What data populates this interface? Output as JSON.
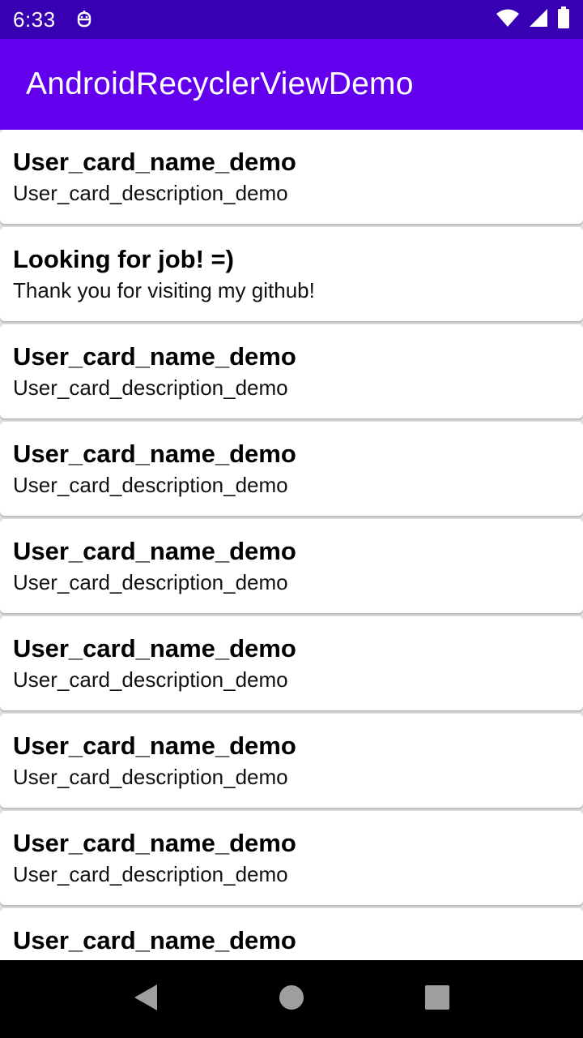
{
  "status_bar": {
    "time": "6:33",
    "icons": [
      "app-notification-icon",
      "wifi-icon",
      "cell-signal-icon",
      "battery-icon"
    ]
  },
  "app_bar": {
    "title": "AndroidRecyclerViewDemo",
    "color": "#6200ee",
    "status_color": "#3700b3"
  },
  "cards": [
    {
      "name": "User_card_name_demo",
      "description": "User_card_description_demo"
    },
    {
      "name": "Looking for job! =)",
      "description": "Thank you for visiting my github!"
    },
    {
      "name": "User_card_name_demo",
      "description": "User_card_description_demo"
    },
    {
      "name": "User_card_name_demo",
      "description": "User_card_description_demo"
    },
    {
      "name": "User_card_name_demo",
      "description": "User_card_description_demo"
    },
    {
      "name": "User_card_name_demo",
      "description": "User_card_description_demo"
    },
    {
      "name": "User_card_name_demo",
      "description": "User_card_description_demo"
    },
    {
      "name": "User_card_name_demo",
      "description": "User_card_description_demo"
    },
    {
      "name": "User_card_name_demo",
      "description": ""
    }
  ],
  "nav_bar": {
    "buttons": [
      "back-icon",
      "home-icon",
      "recents-icon"
    ]
  }
}
